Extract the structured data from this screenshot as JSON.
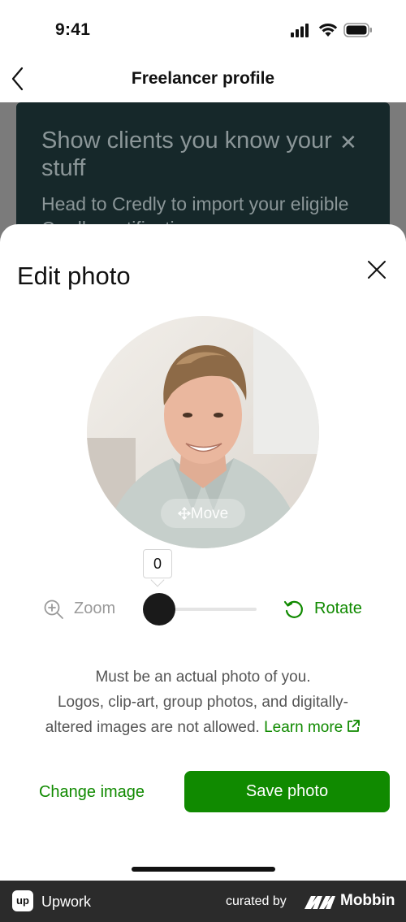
{
  "status_bar": {
    "time": "9:41"
  },
  "nav": {
    "title": "Freelancer profile"
  },
  "banner": {
    "title": "Show clients you know your stuff",
    "subtitle": "Head to Credly to import your eligible Credly certifications"
  },
  "sheet": {
    "title": "Edit photo",
    "move_label": "Move",
    "zoom_value": "0",
    "zoom_label": "Zoom",
    "rotate_label": "Rotate",
    "notice_line1": "Must be an actual photo of you.",
    "notice_line2": "Logos, clip-art, group photos, and digitally-",
    "notice_line3": "altered images are not allowed.",
    "learn_more": "Learn more",
    "change_image": "Change image",
    "save_photo": "Save photo"
  },
  "footer": {
    "app_logo_text": "up",
    "app_name": "Upwork",
    "curated_by": "curated by",
    "brand": "Mobbin"
  },
  "colors": {
    "accent": "#108a00",
    "banner_bg": "#16282a",
    "footer_bg": "#2b2b2b"
  },
  "icons": [
    "back-chevron-icon",
    "close-icon",
    "zoom-in-icon",
    "rotate-icon",
    "external-link-icon",
    "move-icon",
    "signal-icon",
    "wifi-icon",
    "battery-icon"
  ]
}
